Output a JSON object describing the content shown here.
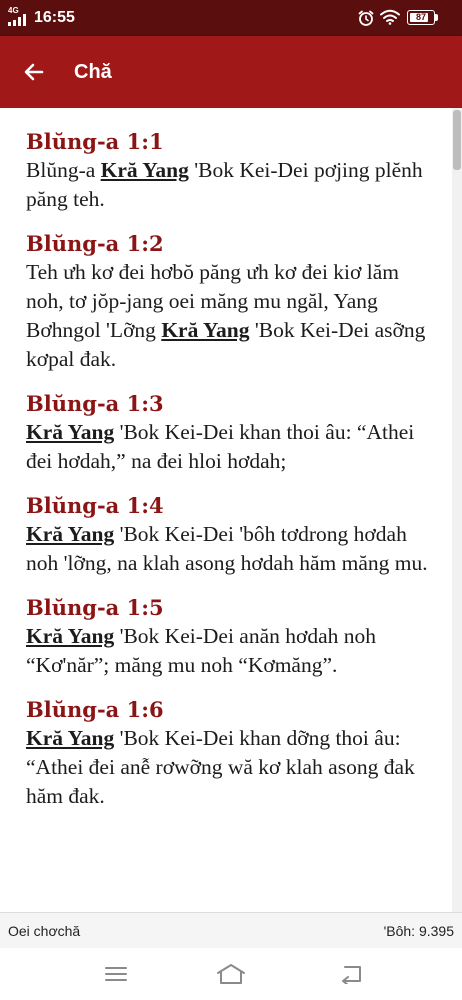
{
  "status_bar": {
    "network": "4G",
    "time": "16:55",
    "battery_level": "87",
    "battery_fraction": 0.87
  },
  "app_bar": {
    "title": "Chă",
    "back_icon": "arrow-left-icon"
  },
  "verses": [
    {
      "ref": "Blŭng-a 1:1",
      "text": [
        {
          "t": "Blŭng-a "
        },
        {
          "t": "Kră Yang",
          "lord": true
        },
        {
          "t": " 'Bok Kei-Dei pơjing plĕnh păng teh."
        }
      ]
    },
    {
      "ref": "Blŭng-a 1:2",
      "text": [
        {
          "t": "Teh ưh kơ đei hơbŏ păng ưh kơ đei kiơ lăm noh, tơ jŏp-jang oei măng mu ngăl, Yang Bơhngol 'Lỡng "
        },
        {
          "t": "Kră Yang",
          "lord": true
        },
        {
          "t": " 'Bok Kei-Dei asỡng kơpal đak."
        }
      ]
    },
    {
      "ref": "Blŭng-a 1:3",
      "text": [
        {
          "t": "Kră Yang",
          "lord": true
        },
        {
          "t": " 'Bok Kei-Dei khan thoi âu: “Athei đei hơdah,” na đei hloi hơdah;"
        }
      ]
    },
    {
      "ref": "Blŭng-a 1:4",
      "text": [
        {
          "t": "Kră Yang",
          "lord": true
        },
        {
          "t": " 'Bok Kei-Dei 'bôh tơdrong hơdah noh 'lỡng, na klah asong hơdah hăm măng mu."
        }
      ]
    },
    {
      "ref": "Blŭng-a 1:5",
      "text": [
        {
          "t": "Kră Yang",
          "lord": true
        },
        {
          "t": " 'Bok Kei-Dei anăn hơdah noh “Kơ'năr”; măng mu noh “Kơmăng”."
        }
      ]
    },
    {
      "ref": "Blŭng-a 1:6",
      "text": [
        {
          "t": "Kră Yang",
          "lord": true
        },
        {
          "t": " 'Bok Kei-Dei khan dỡng thoi âu: “Athei đei anễ rơwỡng wă kơ klah asong đak hăm đak."
        }
      ]
    }
  ],
  "info_bar": {
    "translation": "Oei chơchă",
    "count": "'Bôh: 9.395"
  },
  "nav_bar": {
    "menu_icon": "menu-icon",
    "home_icon": "home-icon",
    "back_icon": "back-icon"
  },
  "colors": {
    "status_bar": "#5a0e0e",
    "app_bar": "#a01818",
    "verse_ref": "#8b1515"
  }
}
